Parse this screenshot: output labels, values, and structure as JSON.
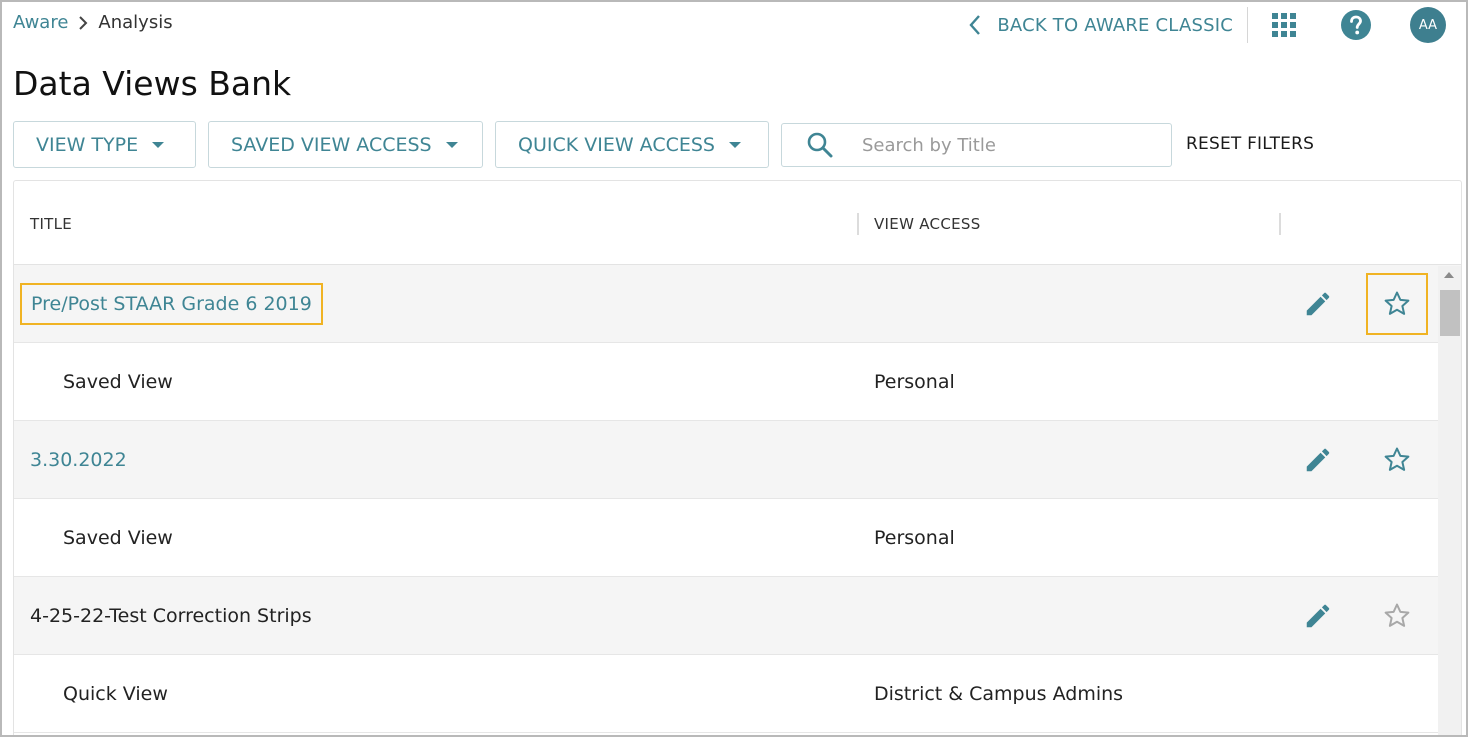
{
  "breadcrumb": {
    "root": "Aware",
    "current": "Analysis"
  },
  "header": {
    "back_label": "BACK TO AWARE CLASSIC",
    "avatar_initials": "AA"
  },
  "page_title": "Data Views Bank",
  "filters": {
    "view_type": "VIEW TYPE",
    "saved_view_access": "SAVED VIEW ACCESS",
    "quick_view_access": "QUICK VIEW ACCESS",
    "search_placeholder": "Search by Title",
    "reset": "RESET FILTERS"
  },
  "table": {
    "col_title": "TITLE",
    "col_access": "VIEW ACCESS",
    "rows": [
      {
        "title": "Pre/Post STAAR Grade 6 2019",
        "type": "Saved View",
        "access": "Personal",
        "favorite": false
      },
      {
        "title": "3.30.2022",
        "type": "Saved View",
        "access": "Personal",
        "favorite": false
      },
      {
        "title": "4-25-22-Test Correction Strips",
        "type": "Quick View",
        "access": "District & Campus Admins",
        "favorite": false
      }
    ]
  },
  "colors": {
    "accent": "#3f8594",
    "highlight": "#f0b323",
    "star_inactive": "#a8a8a8"
  }
}
